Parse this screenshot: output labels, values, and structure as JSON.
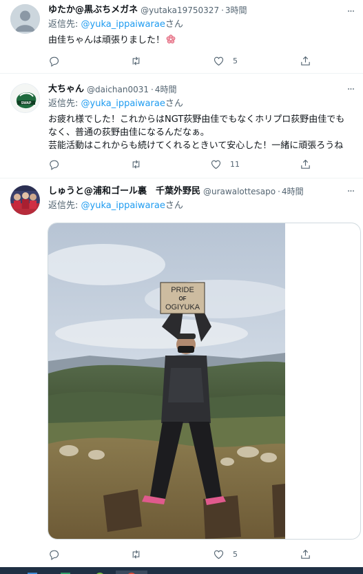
{
  "tweets": [
    {
      "display_name": "ゆたか@黒ぶちメガネ",
      "handle": "@yutaka19750327",
      "dot": "·",
      "time": "3時間",
      "reply_prefix": "返信先: ",
      "reply_mention": "@yuka_ippaiwarae",
      "reply_suffix": "さん",
      "text": "由佳ちゃんは頑張りました！",
      "emoji": "flower-emoji",
      "reply_count": "",
      "retweet_count": "",
      "like_count": "5"
    },
    {
      "display_name": "大ちゃん",
      "handle": "@daichan0031",
      "dot": "·",
      "time": "4時間",
      "reply_prefix": "返信先: ",
      "reply_mention": "@yuka_ippaiwarae",
      "reply_suffix": "さん",
      "text": "お疲れ様でした！これからはNGT荻野由佳でもなくホリプロ荻野由佳でもなく、普通の荻野由佳になるんだなぁ。\n芸能活動はこれからも続けてくれるときいて安心した！一緒に頑張ろうね",
      "reply_count": "",
      "retweet_count": "",
      "like_count": "11"
    },
    {
      "display_name": "しゅうと@浦和ゴール裏　千葉外野民",
      "handle": "@urawalottesapo",
      "dot": "·",
      "time": "4時間",
      "reply_prefix": "返信先: ",
      "reply_mention": "@yuka_ippaiwarae",
      "reply_suffix": "さん",
      "sign_text_line1": "PRIDE",
      "sign_text_line2": "OF",
      "sign_text_line3": "OGIYUKA",
      "reply_count": "",
      "retweet_count": "",
      "like_count": "5"
    }
  ],
  "icons": {
    "reply": "reply-icon",
    "retweet": "retweet-icon",
    "like": "heart-icon",
    "share": "share-icon",
    "more": "more-icon"
  },
  "colors": {
    "link": "#1d9bf0",
    "secondary_text": "#536471",
    "primary_text": "#0f1419",
    "divider": "#eff3f4"
  }
}
